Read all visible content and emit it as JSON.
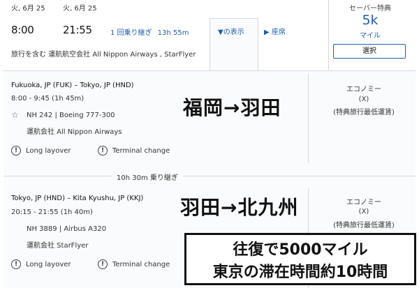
{
  "header": {
    "depart": {
      "date": "火, 6月 25",
      "time": "8:00"
    },
    "arrive": {
      "date": "火, 6月 25",
      "time": "21:55"
    },
    "stops": "1 回乗り継ぎ",
    "duration": "13h 55m",
    "details_toggle": "▼の表示",
    "seats_toggle": "▶ 座席",
    "fare": {
      "name": "セーバー特典",
      "amount": "5k",
      "unit": "マイル",
      "select": "選択"
    },
    "operated": "旅行を含む 運航航空会社 All Nippon Airways , StarFlyer"
  },
  "segments": [
    {
      "route": "Fukuoka, JP (FUK) – Tokyo, JP (HND)",
      "time": "8:00 - 9:45 (1h 45m)",
      "flight": "NH 242 | Boeing 777-300",
      "operator": "運航会社 All Nippon Airways",
      "cabin": "エコノミー",
      "code": "(X)",
      "fare_type": "(特典旅行最低運賃)",
      "alerts": [
        "Long layover",
        "Terminal change"
      ],
      "overlay": "福岡→羽田"
    },
    {
      "route": "Tokyo, JP (HND) – Kita Kyushu, JP (KKJ)",
      "time": "20:15 - 21:55 (1h 40m)",
      "flight": "NH 3889 | Airbus A320",
      "operator": "運航会社 StarFlyer",
      "cabin": "エコノミー",
      "code": "(X)",
      "fare_type": "(特典旅行最低運賃)",
      "alerts": [
        "Long layover",
        "Terminal change"
      ],
      "overlay": "羽田→北九州"
    }
  ],
  "layover": "10h 30m 乗り継ぎ",
  "note_box": {
    "line1": "往復で5000マイル",
    "line2": "東京の滞在時間約10時間"
  },
  "icons": {
    "star": "star-icon",
    "warning": "exclamation-circle-icon"
  },
  "colors": {
    "link": "#1f5fa6",
    "border": "#d3d7de"
  }
}
